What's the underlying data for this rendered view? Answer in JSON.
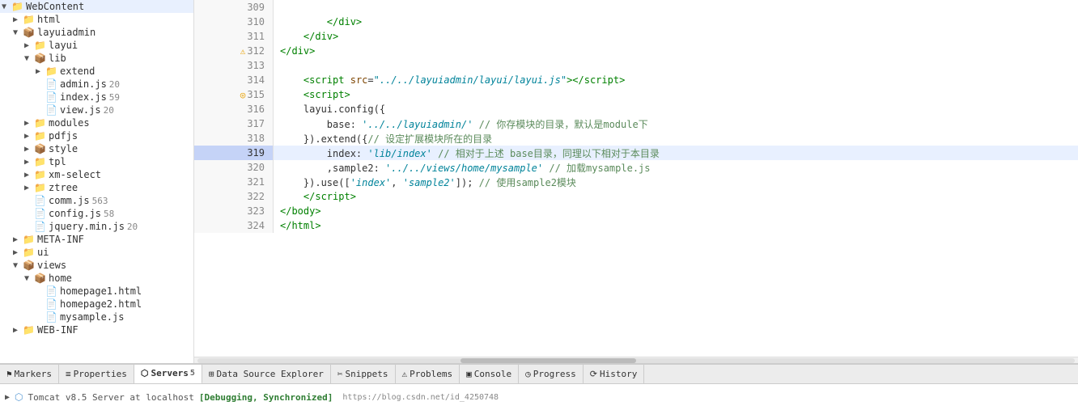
{
  "sidebar": {
    "items": [
      {
        "id": "webcontent",
        "label": "WebContent",
        "indent": 0,
        "type": "root",
        "expanded": true,
        "arrow": "▼"
      },
      {
        "id": "html",
        "label": "html",
        "indent": 1,
        "type": "folder",
        "expanded": false,
        "arrow": "▶"
      },
      {
        "id": "layuiadmin",
        "label": "layuiadmin",
        "indent": 1,
        "type": "package",
        "expanded": true,
        "arrow": "▼"
      },
      {
        "id": "layui",
        "label": "layui",
        "indent": 2,
        "type": "folder",
        "expanded": false,
        "arrow": "▶"
      },
      {
        "id": "lib",
        "label": "lib",
        "indent": 2,
        "type": "package",
        "expanded": true,
        "arrow": "▼"
      },
      {
        "id": "extend",
        "label": "extend",
        "indent": 3,
        "type": "folder",
        "expanded": false,
        "arrow": "▶"
      },
      {
        "id": "admin.js",
        "label": "admin.js",
        "indent": 3,
        "type": "file",
        "badge": "20",
        "arrow": ""
      },
      {
        "id": "index.js",
        "label": "index.js",
        "indent": 3,
        "type": "file",
        "badge": "59",
        "arrow": ""
      },
      {
        "id": "view.js",
        "label": "view.js",
        "indent": 3,
        "type": "file",
        "badge": "20",
        "arrow": ""
      },
      {
        "id": "modules",
        "label": "modules",
        "indent": 2,
        "type": "folder",
        "expanded": false,
        "arrow": "▶"
      },
      {
        "id": "pdfjs",
        "label": "pdfjs",
        "indent": 2,
        "type": "folder",
        "expanded": false,
        "arrow": "▶"
      },
      {
        "id": "style",
        "label": "style",
        "indent": 2,
        "type": "package",
        "expanded": false,
        "arrow": "▶"
      },
      {
        "id": "tpl",
        "label": "tpl",
        "indent": 2,
        "type": "folder",
        "expanded": false,
        "arrow": "▶"
      },
      {
        "id": "xm-select",
        "label": "xm-select",
        "indent": 2,
        "type": "folder",
        "expanded": false,
        "arrow": "▶"
      },
      {
        "id": "ztree",
        "label": "ztree",
        "indent": 2,
        "type": "folder",
        "expanded": false,
        "arrow": "▶"
      },
      {
        "id": "comm.js",
        "label": "comm.js",
        "indent": 2,
        "type": "file",
        "badge": "563",
        "arrow": ""
      },
      {
        "id": "config.js",
        "label": "config.js",
        "indent": 2,
        "type": "file",
        "badge": "58",
        "arrow": ""
      },
      {
        "id": "jquery.min.js",
        "label": "jquery.min.js",
        "indent": 2,
        "type": "file",
        "badge": "20",
        "arrow": ""
      },
      {
        "id": "META-INF",
        "label": "META-INF",
        "indent": 1,
        "type": "folder",
        "expanded": false,
        "arrow": "▶"
      },
      {
        "id": "ui",
        "label": "ui",
        "indent": 1,
        "type": "folder",
        "expanded": false,
        "arrow": "▶"
      },
      {
        "id": "views",
        "label": "views",
        "indent": 1,
        "type": "package",
        "expanded": true,
        "arrow": "▼"
      },
      {
        "id": "home",
        "label": "home",
        "indent": 2,
        "type": "package",
        "expanded": true,
        "arrow": "▼"
      },
      {
        "id": "homepage1.html",
        "label": "homepage1.html",
        "indent": 3,
        "type": "file",
        "badge": "",
        "arrow": ""
      },
      {
        "id": "homepage2.html",
        "label": "homepage2.html",
        "indent": 3,
        "type": "file",
        "badge": "",
        "arrow": ""
      },
      {
        "id": "mysample.js",
        "label": "mysample.js",
        "indent": 3,
        "type": "file",
        "badge": "",
        "arrow": ""
      },
      {
        "id": "WEB-INF",
        "label": "WEB-INF",
        "indent": 1,
        "type": "folder",
        "expanded": false,
        "arrow": "▶"
      }
    ]
  },
  "editor": {
    "lines": [
      {
        "num": 309,
        "highlight": false,
        "gutter": "",
        "content_html": ""
      },
      {
        "num": 310,
        "highlight": false,
        "gutter": "",
        "content_html": "        <span class='tag'>&lt;/div&gt;</span>"
      },
      {
        "num": 311,
        "highlight": false,
        "gutter": "",
        "content_html": "    <span class='tag'>&lt;/div&gt;</span>"
      },
      {
        "num": 312,
        "highlight": false,
        "gutter": "⚠",
        "content_html": "<span class='tag'>&lt;/div&gt;</span>"
      },
      {
        "num": 313,
        "highlight": false,
        "gutter": "",
        "content_html": ""
      },
      {
        "num": 314,
        "highlight": false,
        "gutter": "",
        "content_html": "    <span class='tag'>&lt;script</span> <span class='attr'>src</span>=<span class='val'>\"../../layuiadmin/layui/layui.js\"</span><span class='tag'>&gt;&lt;/script&gt;</span>"
      },
      {
        "num": 315,
        "highlight": false,
        "gutter": "◎",
        "content_html": "    <span class='tag'>&lt;script&gt;</span>"
      },
      {
        "num": 316,
        "highlight": false,
        "gutter": "",
        "content_html": "    <span class='plain'>layui.config({</span>"
      },
      {
        "num": 317,
        "highlight": false,
        "gutter": "",
        "content_html": "        <span class='plain'>base: </span><span class='str'>'../../layuiadmin/'</span> <span class='comment'>// 你存模块的目录，默认是module下</span>"
      },
      {
        "num": 318,
        "highlight": false,
        "gutter": "",
        "content_html": "    <span class='plain'>}).extend({</span><span class='comment'>// 设定扩展模块所在的目录</span>"
      },
      {
        "num": 319,
        "highlight": true,
        "gutter": "",
        "content_html": "        <span class='plain'>index: </span><span class='str'>'lib/index'</span> <span class='comment'>// 相对于上述 base目录，同理以下相对于本目录</span>"
      },
      {
        "num": 320,
        "highlight": false,
        "gutter": "",
        "content_html": "        <span class='plain'>,sample2: </span><span class='str'>'../../views/home/mysample'</span> <span class='comment'>// 加载mysample.js</span>"
      },
      {
        "num": 321,
        "highlight": false,
        "gutter": "",
        "content_html": "    <span class='plain'>}).use([</span><span class='str'>'index'</span><span class='plain'>, </span><span class='str'>'sample2'</span><span class='plain'>]); </span><span class='comment'>// 使用sample2模块</span>"
      },
      {
        "num": 322,
        "highlight": false,
        "gutter": "",
        "content_html": "    <span class='tag'>&lt;/script&gt;</span>"
      },
      {
        "num": 323,
        "highlight": false,
        "gutter": "",
        "content_html": "<span class='tag'>&lt;/body&gt;</span>"
      },
      {
        "num": 324,
        "highlight": false,
        "gutter": "",
        "content_html": "<span class='tag'>&lt;/html&gt;</span>"
      }
    ]
  },
  "bottom_panel": {
    "tabs": [
      {
        "id": "markers",
        "label": "Markers",
        "icon": "⚑",
        "badge": "",
        "active": false
      },
      {
        "id": "properties",
        "label": "Properties",
        "icon": "≡",
        "badge": "",
        "active": false
      },
      {
        "id": "servers",
        "label": "Servers",
        "icon": "⬡",
        "badge": "5",
        "active": true
      },
      {
        "id": "datasource",
        "label": "Data Source Explorer",
        "icon": "⊞",
        "badge": "",
        "active": false
      },
      {
        "id": "snippets",
        "label": "Snippets",
        "icon": "✂",
        "badge": "",
        "active": false
      },
      {
        "id": "problems",
        "label": "Problems",
        "icon": "⚠",
        "badge": "",
        "active": false
      },
      {
        "id": "console",
        "label": "Console",
        "icon": "▣",
        "badge": "",
        "active": false
      },
      {
        "id": "progress",
        "label": "Progress",
        "icon": "◷",
        "badge": "",
        "active": false
      },
      {
        "id": "history",
        "label": "History",
        "icon": "⟳",
        "badge": "",
        "active": false
      }
    ],
    "server_row": {
      "icon": "⬡",
      "arrow": "▶",
      "label": "Tomcat v8.5 Server at localhost",
      "status": "[Debugging, Synchronized]",
      "url": "https://blog.csdn.net/id_4250748"
    }
  }
}
